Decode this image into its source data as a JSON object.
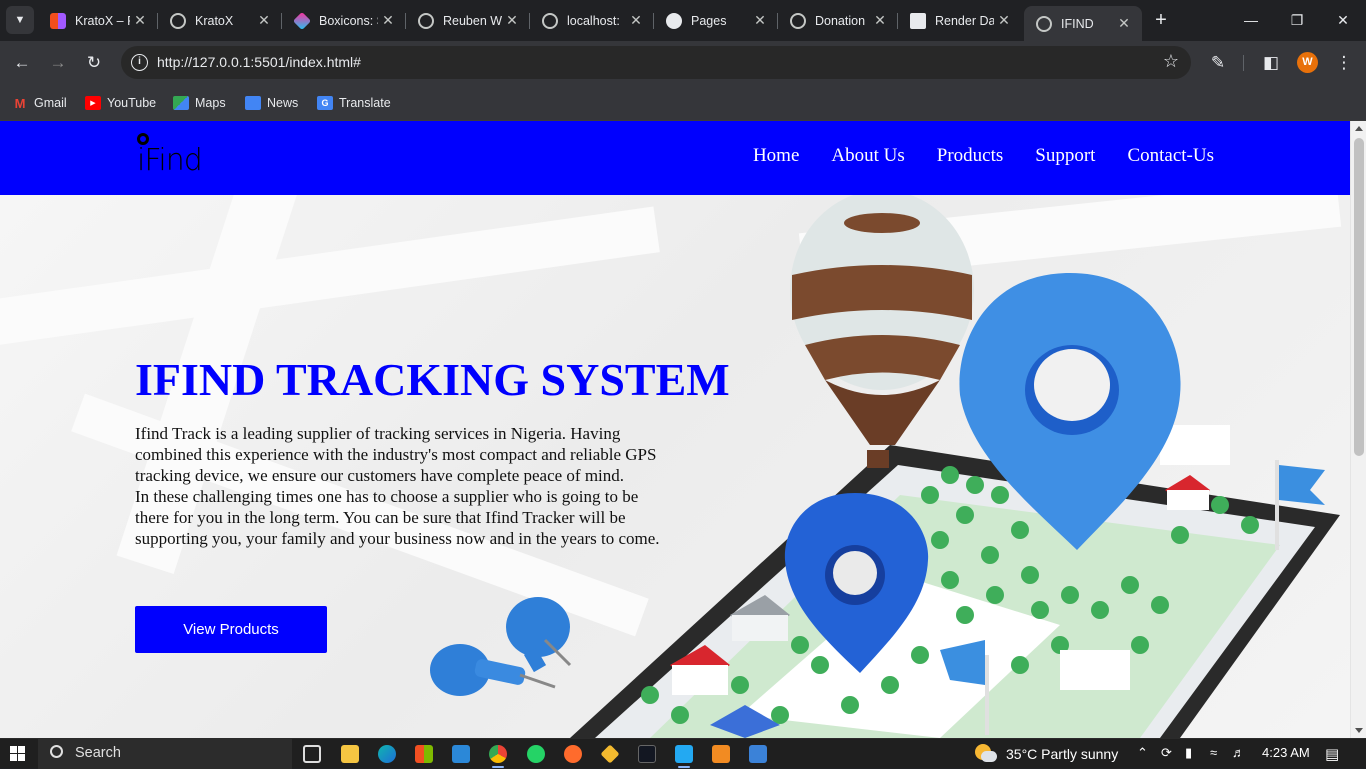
{
  "browser": {
    "tabs": [
      {
        "title": "KratoX – F",
        "active": false
      },
      {
        "title": "KratoX",
        "active": false
      },
      {
        "title": "Boxicons: S",
        "active": false
      },
      {
        "title": "Reuben W",
        "active": false
      },
      {
        "title": "localhost:",
        "active": false
      },
      {
        "title": "Pages",
        "active": false
      },
      {
        "title": "Donation",
        "active": false
      },
      {
        "title": "Render Da",
        "active": false
      },
      {
        "title": "IFIND",
        "active": true
      }
    ],
    "url": "http://127.0.0.1:5501/index.html#",
    "profile_initial": "W",
    "bookmarks": [
      "Gmail",
      "YouTube",
      "Maps",
      "News",
      "Translate"
    ]
  },
  "site": {
    "logo_text": "iFind",
    "nav": [
      "Home",
      "About Us",
      "Products",
      "Support",
      "Contact-Us"
    ],
    "hero": {
      "title": "IFIND TRACKING SYSTEM",
      "paragraph1": "Ifind Track is a leading supplier of tracking services in Nigeria. Having combined this experience with the industry's most compact and reliable GPS tracking device, we ensure our customers have complete peace of mind.",
      "paragraph2": "In these challenging times one has to choose a supplier who is going to be there for you in the long term. You can be sure that Ifind Tracker will be supporting you, your family and your business now and in the years to come.",
      "button": "View Products"
    },
    "colors": {
      "brand": "#0000fe"
    }
  },
  "taskbar": {
    "search_label": "Search",
    "weather": "35°C  Partly sunny",
    "time": "4:23 AM"
  }
}
